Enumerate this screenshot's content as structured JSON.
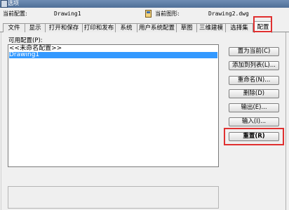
{
  "window": {
    "title": "选项"
  },
  "info": {
    "current_profile_label": "当前配置:",
    "current_profile_value": "Drawing1",
    "current_drawing_label": "当前图形:",
    "current_drawing_value": "Drawing2.dwg"
  },
  "tabs": [
    {
      "label": "文件"
    },
    {
      "label": "显示"
    },
    {
      "label": "打开和保存"
    },
    {
      "label": "打印和发布"
    },
    {
      "label": "系统"
    },
    {
      "label": "用户系统配置"
    },
    {
      "label": "草图"
    },
    {
      "label": "三维建模"
    },
    {
      "label": "选择集"
    },
    {
      "label": "配置"
    }
  ],
  "profiles": {
    "label": "可用配置(P):",
    "items": [
      {
        "label": "<<未命名配置>>"
      },
      {
        "label": "Drawing1"
      }
    ]
  },
  "buttons": {
    "set_current": "置为当前(C)",
    "add_to_list": "添加到列表(L)...",
    "rename": "重命名(N)...",
    "delete": "删除(D)",
    "export": "输出(E)...",
    "import": "输入(I)...",
    "reset": "重置(R)"
  },
  "colors": {
    "selection": "#3399ff",
    "highlight_box": "#e03030"
  }
}
